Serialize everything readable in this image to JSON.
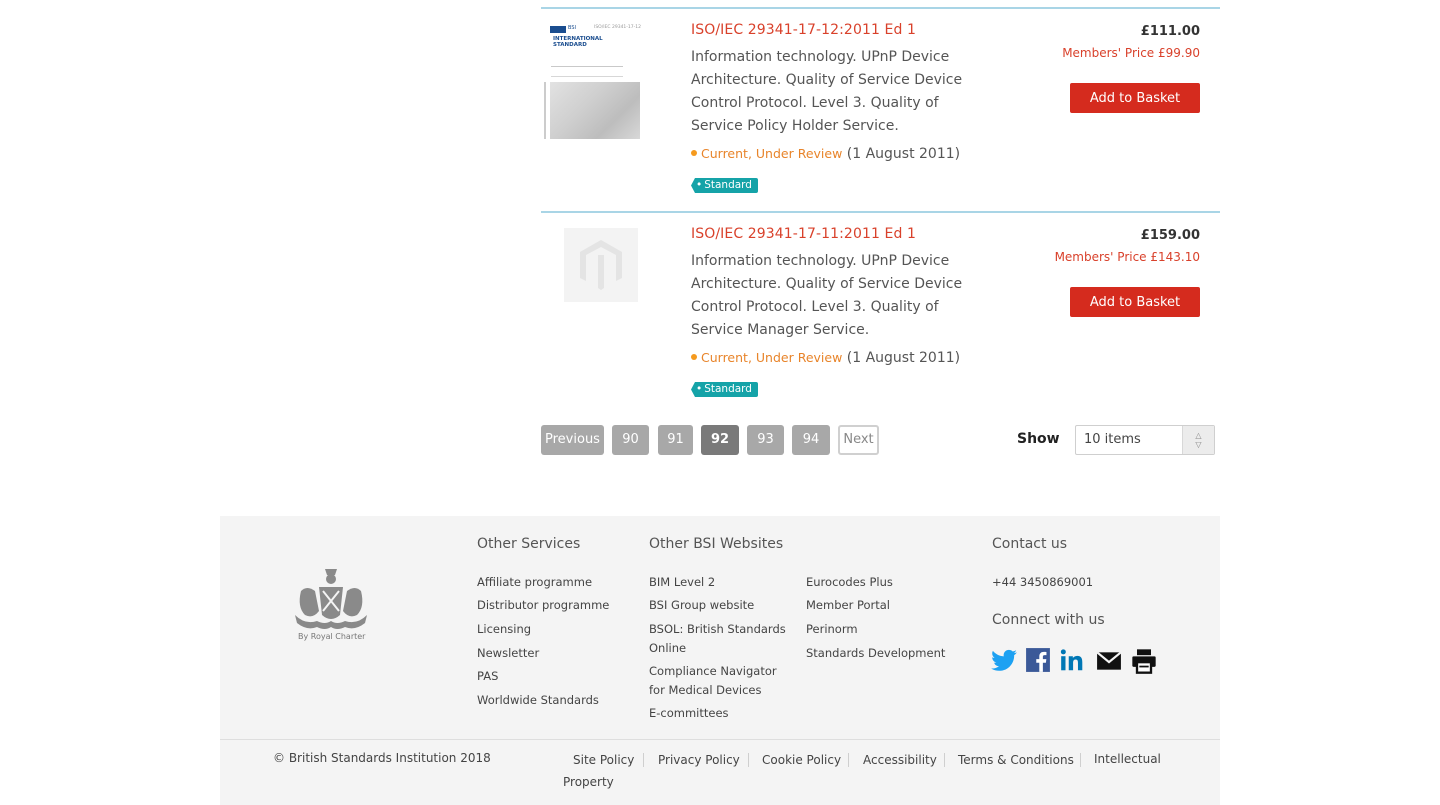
{
  "products": [
    {
      "title": "ISO/IEC 29341-17-12:2011 Ed 1",
      "description": "Information technology. UPnP Device Architecture. Quality of Service Device Control Protocol. Level 3. Quality of Service Policy Holder Service.",
      "status": "Current, Under Review",
      "date": "(1 August 2011)",
      "tag": "Standard",
      "price": "£111.00",
      "members_price": "Members' Price  £99.90",
      "button": "Add to Basket",
      "thumb_text": {
        "bsi": "BSI",
        "ref": "ISO/IEC 29341-17-12",
        "standard": "INTERNATIONAL STANDARD"
      }
    },
    {
      "title": "ISO/IEC 29341-17-11:2011 Ed 1",
      "description": "Information technology. UPnP Device Architecture. Quality of Service Device Control Protocol. Level 3. Quality of Service Manager Service.",
      "status": "Current, Under Review",
      "date": "(1 August 2011)",
      "tag": "Standard",
      "price": "£159.00",
      "members_price": "Members' Price  £143.10",
      "button": "Add to Basket"
    }
  ],
  "pagination": {
    "previous": "Previous",
    "pages": [
      "90",
      "91",
      "92",
      "93",
      "94"
    ],
    "current": "92",
    "next": "Next"
  },
  "show": {
    "label": "Show",
    "value": "10 items"
  },
  "footer": {
    "crest_caption": "By Royal Charter",
    "other_services": {
      "heading": "Other Services",
      "links": [
        "Affiliate programme",
        "Distributor programme",
        "Licensing",
        "Newsletter",
        "PAS",
        "Worldwide Standards"
      ]
    },
    "other_websites": {
      "heading": "Other BSI Websites",
      "col1": [
        "BIM Level 2",
        "BSI Group website",
        "BSOL: British Standards Online",
        "Compliance Navigator for Medical Devices",
        "E-committees"
      ],
      "col2": [
        "Eurocodes Plus",
        "Member Portal",
        "Perinorm",
        "Standards Development"
      ]
    },
    "contact": {
      "heading": "Contact us",
      "phone": "+44 3450869001",
      "connect": "Connect with us"
    },
    "social_icons": [
      "twitter-icon",
      "facebook-icon",
      "linkedin-icon",
      "email-icon",
      "print-icon"
    ],
    "copyright": "© British Standards Institution 2018",
    "legal_links": [
      "Site Policy",
      "Privacy Policy",
      "Cookie Policy",
      "Accessibility",
      "Terms & Conditions",
      "Intellectual Property"
    ]
  },
  "colors": {
    "accent": "#d52b1e",
    "link": "#d9412b",
    "tag": "#15a3a8",
    "status_dot": "#f59a1e",
    "twitter": "#1da1f2",
    "facebook": "#3b5998",
    "linkedin": "#0077b5"
  }
}
